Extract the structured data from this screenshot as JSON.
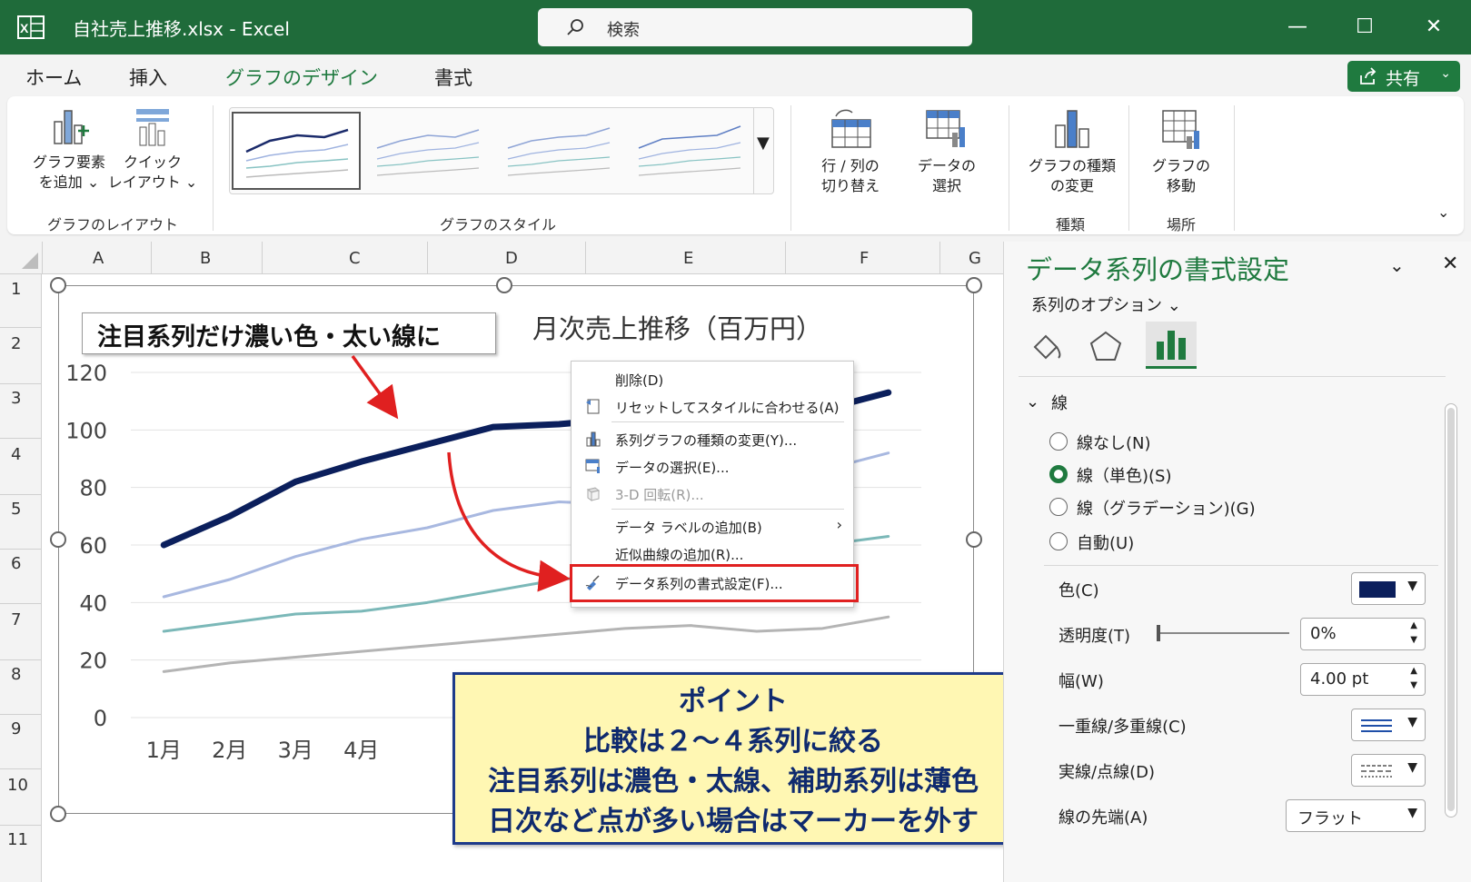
{
  "window": {
    "title": "自社売上推移.xlsx  -  Excel",
    "search_label": "検索"
  },
  "tabs": [
    "ホーム",
    "挿入",
    "グラフのデザイン",
    "書式"
  ],
  "share_label": "共有",
  "ribbon": {
    "add_element": [
      "グラフ要素",
      "を追加 ⌄"
    ],
    "quick_layout": [
      "クイック",
      "レイアウト ⌄"
    ],
    "layout_group": "グラフのレイアウト",
    "style_group": "グラフのスタイル",
    "switch_row_col": [
      "行 / 列の",
      "切り替え"
    ],
    "select_data": [
      "データの",
      "選択"
    ],
    "change_type": [
      "グラフの種類",
      "の変更"
    ],
    "type_group": "種類",
    "move_chart": [
      "グラフの",
      "移動"
    ],
    "location_group": "場所"
  },
  "columns": [
    "A",
    "B",
    "C",
    "D",
    "E",
    "F",
    "G"
  ],
  "rows": [
    "1",
    "2",
    "3",
    "4",
    "5",
    "6",
    "7",
    "8",
    "9",
    "10",
    "11"
  ],
  "callout_top": "注目系列だけ濃い色・太い線に",
  "chart_data": {
    "type": "line",
    "title": "月次売上推移（百万円）",
    "categories": [
      "1月",
      "2月",
      "3月",
      "4月"
    ],
    "yticks": [
      "120",
      "100",
      "80",
      "60",
      "40",
      "20",
      "0"
    ],
    "ylim": [
      0,
      120
    ],
    "x_count": 12,
    "grid": true,
    "series": [
      {
        "color": "#0b1f5c",
        "emphasis": true,
        "values": [
          60,
          70,
          82,
          89,
          95,
          101,
          102,
          104,
          106,
          103,
          107,
          113
        ]
      },
      {
        "color": "#a8b8e0",
        "emphasis": false,
        "values": [
          42,
          48,
          56,
          62,
          66,
          72,
          75,
          74,
          71,
          79,
          86,
          92
        ]
      },
      {
        "color": "#7bb8b8",
        "emphasis": false,
        "values": [
          30,
          33,
          36,
          37,
          40,
          44,
          48,
          50,
          54,
          58,
          60,
          63
        ]
      },
      {
        "color": "#b4b4b4",
        "emphasis": false,
        "values": [
          16,
          19,
          21,
          23,
          25,
          27,
          29,
          31,
          32,
          30,
          31,
          35
        ]
      }
    ]
  },
  "context_menu": {
    "items": [
      {
        "label": "削除(D)",
        "icon": "none",
        "disabled": false
      },
      {
        "label": "リセットしてスタイルに合わせる(A)",
        "icon": "reset-icon",
        "disabled": false
      },
      {
        "label": "系列グラフの種類の変更(Y)...",
        "icon": "chart-type-icon",
        "disabled": false
      },
      {
        "label": "データの選択(E)...",
        "icon": "select-data-icon",
        "disabled": false
      },
      {
        "label": "3-D 回転(R)...",
        "icon": "cube-icon",
        "disabled": true
      },
      {
        "label": "データ ラベルの追加(B)",
        "icon": "none",
        "disabled": false,
        "submenu": true
      },
      {
        "label": "近似曲線の追加(R)...",
        "icon": "none",
        "disabled": false
      },
      {
        "label": "データ系列の書式設定(F)...",
        "icon": "format-series-icon",
        "disabled": false
      }
    ]
  },
  "point_box": {
    "heading": "ポイント",
    "lines": [
      "比較は２～４系列に絞る",
      "注目系列は濃色・太線、補助系列は薄色",
      "日次など点が多い場合はマーカーを外す"
    ]
  },
  "pane": {
    "title": "データ系列の書式設定",
    "options_label": "系列のオプション ⌄",
    "section": "線",
    "radios": [
      {
        "label": "線なし(N)",
        "checked": false
      },
      {
        "label": "線（単色)(S)",
        "checked": true
      },
      {
        "label": "線（グラデーション)(G)",
        "checked": false
      },
      {
        "label": "自動(U)",
        "checked": false
      }
    ],
    "color_label": "色(C)",
    "color_value": "#0b1f5c",
    "transparency_label": "透明度(T)",
    "transparency_value": "0%",
    "width_label": "幅(W)",
    "width_value": "4.00 pt",
    "compound_label": "一重線/多重線(C)",
    "dash_label": "実線/点線(D)",
    "cap_label": "線の先端(A)",
    "cap_value": "フラット"
  },
  "colors": {
    "excel_green": "#1f6b3a",
    "accent_green": "#1f7a3f",
    "highlight_red": "#e02020",
    "note_yellow": "#fff7b3"
  }
}
